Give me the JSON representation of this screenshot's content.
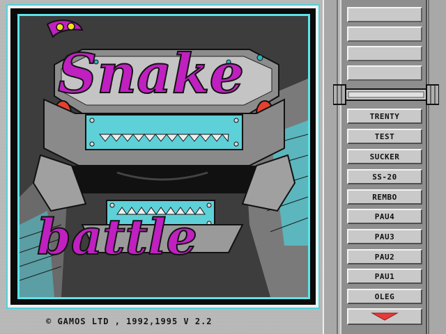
{
  "title_art": {
    "title_word_1": "Snake",
    "title_word_2": "battle"
  },
  "footer": {
    "copyright": "© GAMOS LTD , 1992,1995 V 2.2"
  },
  "player_list": {
    "items": [
      "TRENTY",
      "TEST",
      "SUCKER",
      "SS-20",
      "REMBO",
      "PAU4",
      "PAU3",
      "PAU2",
      "PAU1",
      "OLEG"
    ]
  },
  "colors": {
    "accent_cyan": "#4fd4dd",
    "title_magenta": "#c020c0",
    "scroll_arrow_red": "#e83a3a"
  },
  "icons": {
    "scroll_down": "triangle-down-icon"
  }
}
